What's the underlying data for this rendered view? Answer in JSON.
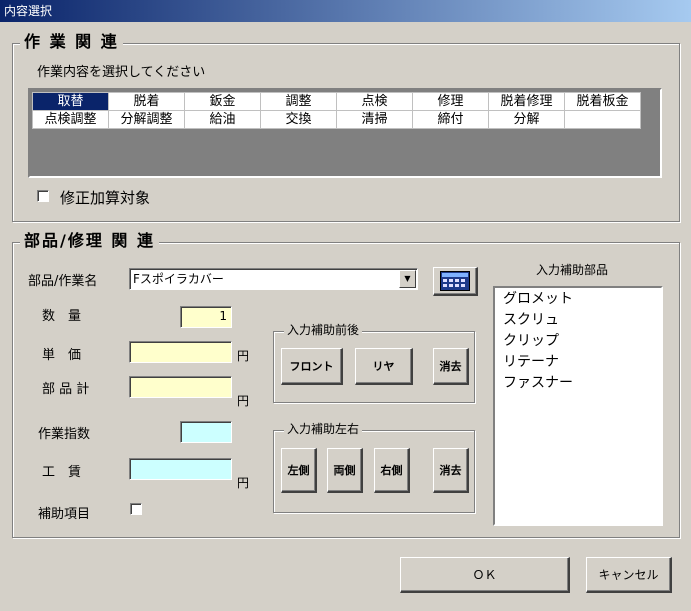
{
  "window": {
    "title": "内容選択"
  },
  "work_group": {
    "title": "作 業 関 連",
    "instruction": "作業内容を選択してください",
    "grid": [
      [
        "取替",
        "脱着",
        "鈑金",
        "調整",
        "点検",
        "修理",
        "脱着修理",
        "脱着板金"
      ],
      [
        "点検調整",
        "分解調整",
        "給油",
        "交換",
        "清掃",
        "締付",
        "分解",
        ""
      ]
    ],
    "selected": "取替",
    "correction_label": "修正加算対象"
  },
  "parts_group": {
    "title": "部品/修理 関 連",
    "part_name_label": "部品/作業名",
    "part_name_value": "Fスポイラカバー",
    "quantity_label": "数　量",
    "quantity_value": "1",
    "unit_price_label": "単　価",
    "unit_price_value": "",
    "parts_total_label": "部 品 計",
    "parts_total_value": "",
    "work_index_label": "作業指数",
    "work_index_value": "",
    "labor_label": "工　賃",
    "labor_value": "",
    "aux_item_label": "補助項目",
    "yen": "円",
    "front_rear": {
      "title": "入力補助前後",
      "front": "フロント",
      "rear": "リヤ",
      "clear": "消去"
    },
    "left_right": {
      "title": "入力補助左右",
      "left": "左側",
      "both": "両側",
      "right": "右側",
      "clear": "消去"
    },
    "aux_parts_title": "入力補助部品",
    "aux_parts": [
      "グロメット",
      "スクリュ",
      "クリップ",
      "リテーナ",
      "ファスナー"
    ]
  },
  "footer": {
    "ok": "ＯＫ",
    "cancel": "キャンセル"
  },
  "colors": {
    "titlebar": "#0a246a",
    "yellow_input": "#ffffcc",
    "cyan_input": "#ccffff",
    "selection": "#0a246a"
  }
}
